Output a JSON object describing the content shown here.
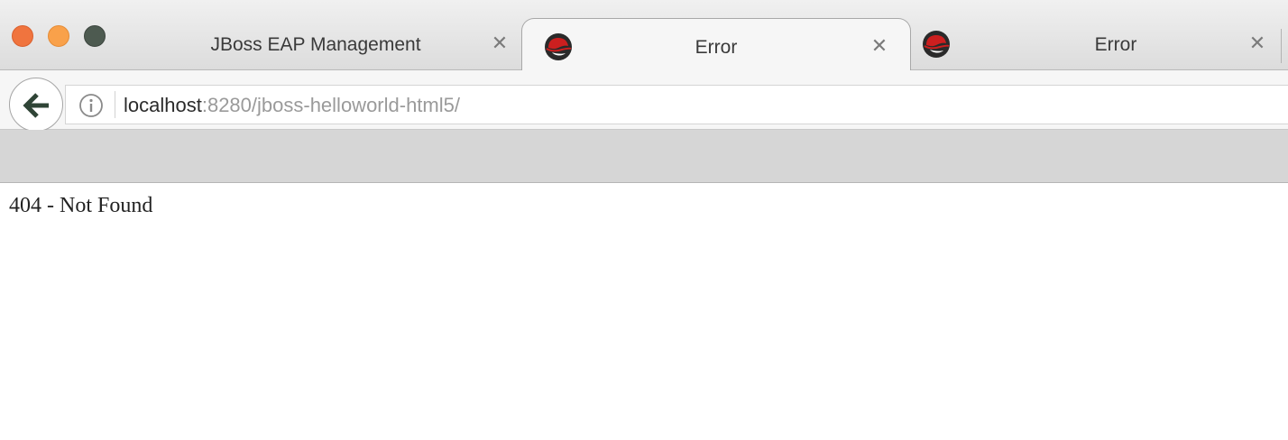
{
  "window": {
    "traffic_lights": {
      "close_color": "#f0743e",
      "minimize_color": "#f9a14a",
      "maximize_color": "#4d5a50"
    }
  },
  "tabs": [
    {
      "title": "JBoss EAP Management",
      "close_glyph": "✕",
      "favicon": "none",
      "active": false
    },
    {
      "title": "Error",
      "close_glyph": "✕",
      "favicon": "redhat-icon",
      "active": true
    },
    {
      "title": "Error",
      "close_glyph": "✕",
      "favicon": "redhat-icon",
      "active": false
    }
  ],
  "navbar": {
    "back_icon": "back-arrow-icon",
    "info_icon": "info-icon",
    "url_host": "localhost",
    "url_rest": ":8280/jboss-helloworld-html5/"
  },
  "page": {
    "message": "404 - Not Found"
  },
  "colors": {
    "favicon_red": "#cc1f1f",
    "favicon_dark": "#2a2a2a"
  }
}
